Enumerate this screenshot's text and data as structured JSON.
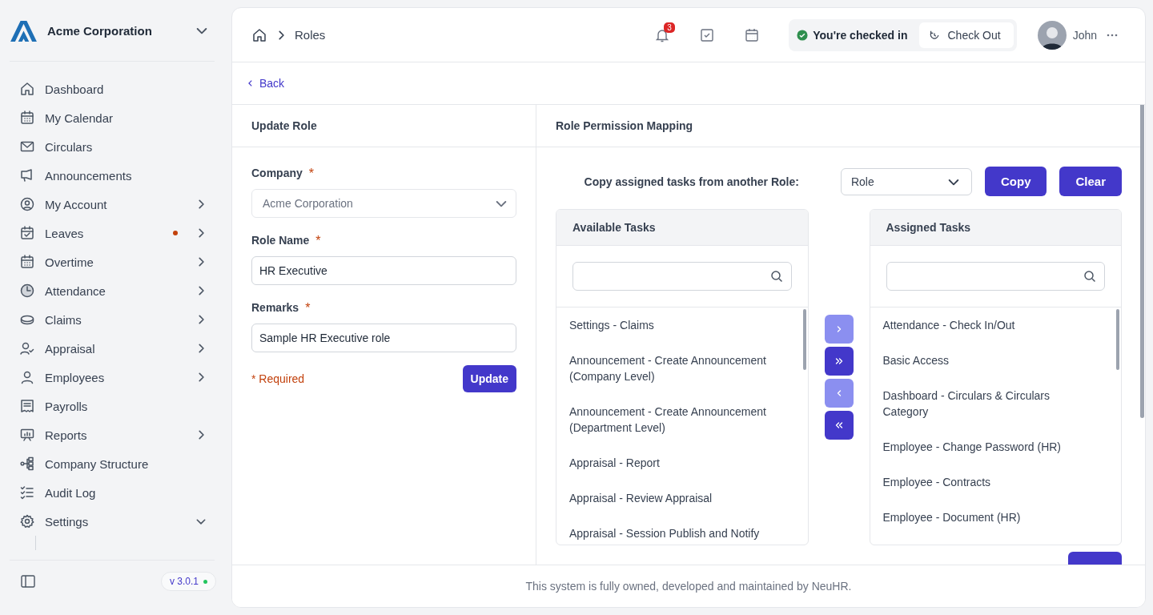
{
  "sidebar": {
    "company": "Acme Corporation",
    "items": [
      {
        "label": "Dashboard",
        "kind": "home",
        "submenu": false,
        "dot": false
      },
      {
        "label": "My Calendar",
        "kind": "calendar",
        "submenu": false,
        "dot": false
      },
      {
        "label": "Circulars",
        "kind": "mail",
        "submenu": false,
        "dot": false
      },
      {
        "label": "Announcements",
        "kind": "megaphone",
        "submenu": false,
        "dot": false
      },
      {
        "label": "My Account",
        "kind": "user-circle",
        "submenu": true,
        "expanded": false,
        "dot": false
      },
      {
        "label": "Leaves",
        "kind": "calendar-check",
        "submenu": true,
        "expanded": false,
        "dot": true
      },
      {
        "label": "Overtime",
        "kind": "calendar",
        "submenu": true,
        "expanded": false,
        "dot": false
      },
      {
        "label": "Attendance",
        "kind": "clock",
        "submenu": true,
        "expanded": false,
        "dot": false
      },
      {
        "label": "Claims",
        "kind": "coin",
        "submenu": true,
        "expanded": false,
        "dot": false
      },
      {
        "label": "Appraisal",
        "kind": "user-check",
        "submenu": true,
        "expanded": false,
        "dot": false
      },
      {
        "label": "Employees",
        "kind": "user",
        "submenu": true,
        "expanded": false,
        "dot": false
      },
      {
        "label": "Payrolls",
        "kind": "receipt",
        "submenu": false,
        "dot": false
      },
      {
        "label": "Reports",
        "kind": "presentation",
        "submenu": true,
        "expanded": false,
        "dot": false
      },
      {
        "label": "Company Structure",
        "kind": "hierarchy",
        "submenu": false,
        "dot": false
      },
      {
        "label": "Audit Log",
        "kind": "checklist",
        "submenu": false,
        "dot": false
      },
      {
        "label": "Settings",
        "kind": "gear",
        "submenu": true,
        "expanded": true,
        "dot": false
      }
    ],
    "version": "v 3.0.1"
  },
  "header": {
    "breadcrumb": [
      "Roles"
    ],
    "notifications": "3",
    "status": "You're checked in",
    "check_out": "Check Out",
    "user": "John"
  },
  "back": "Back",
  "update_role": {
    "title": "Update Role",
    "fields": [
      {
        "label": "Company",
        "required_mark": "*",
        "value": "Acme Corporation",
        "kind": "select",
        "disabled": true
      },
      {
        "label": "Role Name",
        "required_mark": "*",
        "value": "HR Executive",
        "kind": "text",
        "disabled": false
      },
      {
        "label": "Remarks",
        "required_mark": "*",
        "value": "Sample HR Executive role",
        "kind": "text",
        "disabled": false
      }
    ],
    "required_note": "* Required",
    "submit": "Update"
  },
  "mapping": {
    "title": "Role Permission Mapping",
    "copy_label": "Copy assigned tasks from another Role:",
    "role_placeholder": "Role",
    "copy": "Copy",
    "clear": "Clear",
    "available": {
      "title": "Available Tasks",
      "items": [
        "Settings - Claims",
        "Announcement - Create Announcement (Company Level)",
        "Announcement - Create Announcement (Department Level)",
        "Appraisal - Report",
        "Appraisal - Review Appraisal",
        "Appraisal - Session Publish and Notify"
      ]
    },
    "transfer": [
      {
        "kind": "one-right",
        "disabled": true
      },
      {
        "kind": "all-right",
        "disabled": false
      },
      {
        "kind": "one-left",
        "disabled": true
      },
      {
        "kind": "all-left",
        "disabled": false
      }
    ],
    "assigned": {
      "title": "Assigned Tasks",
      "items": [
        "Attendance - Check In/Out",
        "Basic Access",
        "Dashboard - Circulars & Circulars Category",
        "Employee - Change Password (HR)",
        "Employee - Contracts",
        "Employee - Document (HR)"
      ]
    }
  },
  "footer": "This system is fully owned, developed and maintained by NeuHR."
}
